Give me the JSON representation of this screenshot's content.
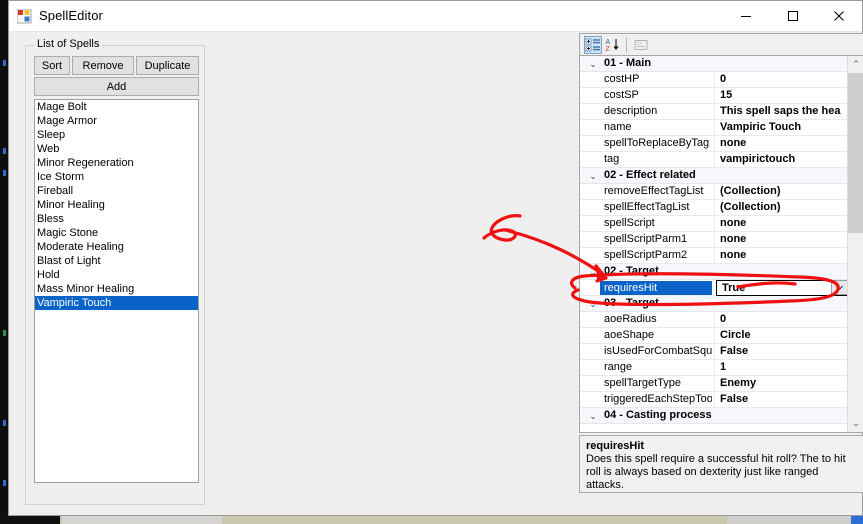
{
  "window": {
    "title": "SpellEditor",
    "icon": "forms-app-icon",
    "controls": {
      "minimize": "─",
      "maximize": "□",
      "close": "✕"
    }
  },
  "spells_group": {
    "legend": "List of Spells",
    "buttons": {
      "sort": "Sort",
      "remove": "Remove",
      "duplicate": "Duplicate",
      "add": "Add"
    },
    "items": [
      {
        "label": "Mage Bolt",
        "selected": false
      },
      {
        "label": "Mage Armor",
        "selected": false
      },
      {
        "label": "Sleep",
        "selected": false
      },
      {
        "label": "Web",
        "selected": false
      },
      {
        "label": "Minor Regeneration",
        "selected": false
      },
      {
        "label": "Ice Storm",
        "selected": false
      },
      {
        "label": "Fireball",
        "selected": false
      },
      {
        "label": "Minor Healing",
        "selected": false
      },
      {
        "label": "Bless",
        "selected": false
      },
      {
        "label": "Magic Stone",
        "selected": false
      },
      {
        "label": "Moderate Healing",
        "selected": false
      },
      {
        "label": "Blast of Light",
        "selected": false
      },
      {
        "label": "Hold",
        "selected": false
      },
      {
        "label": "Mass Minor Healing",
        "selected": false
      },
      {
        "label": "Vampiric Touch",
        "selected": true
      }
    ]
  },
  "property_grid": {
    "toolbar": {
      "categorized": "categorized-view-icon",
      "alphabetical": "alphabetical-sort-icon",
      "property_pages": "property-pages-icon"
    },
    "rows": [
      {
        "type": "category",
        "chev": "⌄",
        "label": "01 - Main"
      },
      {
        "type": "property",
        "name": "costHP",
        "value": "0"
      },
      {
        "type": "property",
        "name": "costSP",
        "value": "15"
      },
      {
        "type": "property",
        "name": "description",
        "value": "This spell saps the hea"
      },
      {
        "type": "property",
        "name": "name",
        "value": "Vampiric Touch"
      },
      {
        "type": "property",
        "name": "spellToReplaceByTag",
        "value": "none"
      },
      {
        "type": "property",
        "name": "tag",
        "value": "vampirictouch"
      },
      {
        "type": "category",
        "chev": "⌄",
        "label": "02 - Effect related"
      },
      {
        "type": "property",
        "name": "removeEffectTagList",
        "value": "(Collection)"
      },
      {
        "type": "property",
        "name": "spellEffectTagList",
        "value": "(Collection)"
      },
      {
        "type": "property",
        "name": "spellScript",
        "value": "none"
      },
      {
        "type": "property",
        "name": "spellScriptParm1",
        "value": "none"
      },
      {
        "type": "property",
        "name": "spellScriptParm2",
        "value": "none"
      },
      {
        "type": "category",
        "chev": "⌄",
        "label": "02 - Target"
      },
      {
        "type": "property",
        "name": "requiresHit",
        "value": "True",
        "selected": true,
        "dropdown": "⌄"
      },
      {
        "type": "category",
        "chev": "⌄",
        "label": "03 - Target"
      },
      {
        "type": "property",
        "name": "aoeRadius",
        "value": "0"
      },
      {
        "type": "property",
        "name": "aoeShape",
        "value": "Circle"
      },
      {
        "type": "property",
        "name": "isUsedForCombatSqua",
        "value": "False"
      },
      {
        "type": "property",
        "name": "range",
        "value": "1"
      },
      {
        "type": "property",
        "name": "spellTargetType",
        "value": "Enemy"
      },
      {
        "type": "property",
        "name": "triggeredEachStepToo",
        "value": "False"
      },
      {
        "type": "category",
        "chev": "⌄",
        "label": "04 - Casting process"
      }
    ],
    "scrollbar": {
      "up": "⌃",
      "down": "⌄"
    },
    "help": {
      "title": "requiresHit",
      "body": "Does this spell require a successful hit roll? The to hit roll is always based on dexterity just like ranged attacks."
    }
  },
  "annotation": {
    "color": "#ee1111",
    "shapes": "arrow-and-ellipse-highlighting-requiresHit-row"
  }
}
